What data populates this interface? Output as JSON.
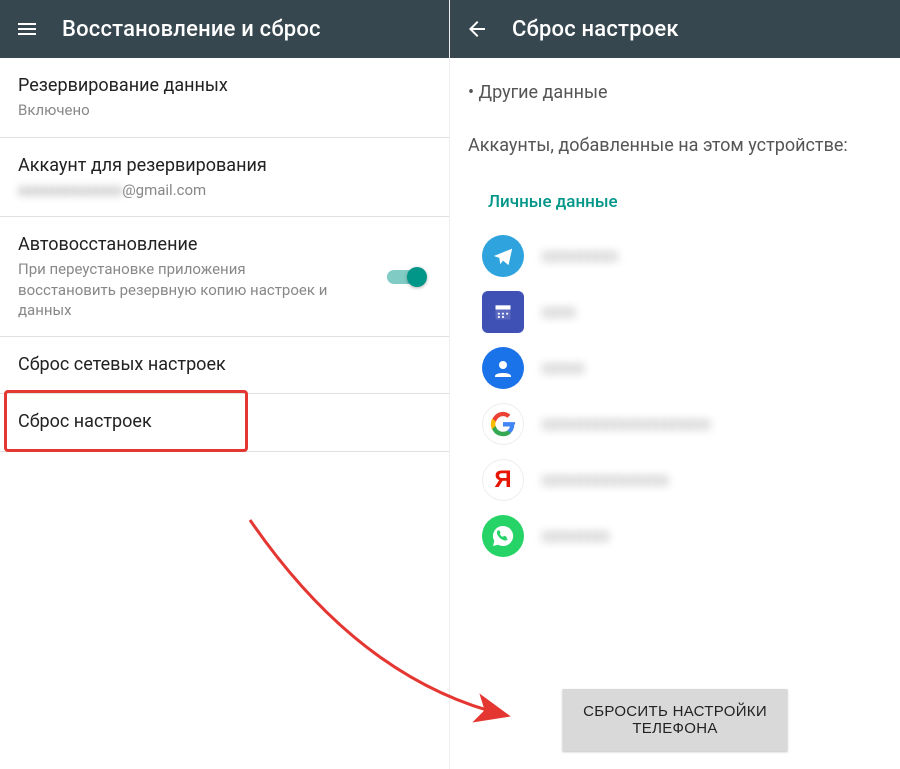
{
  "left": {
    "title": "Восстановление и сброс",
    "items": [
      {
        "primary": "Резервирование данных",
        "secondary": "Включено"
      },
      {
        "primary": "Аккаунт для резервирования",
        "secondary_blur": "xxxxxxxxxxxxxx@gmail.com",
        "suffix": "@gmail.com"
      },
      {
        "primary": "Автовосстановление",
        "secondary": "При переустановке приложения восстановить резервную копию настроек и данных",
        "toggle": true
      },
      {
        "primary": "Сброс сетевых настроек"
      },
      {
        "primary": "Сброс настроек",
        "highlight": true
      }
    ]
  },
  "right": {
    "title": "Сброс настроек",
    "bullet": "• Другие данные",
    "accounts_heading": "Аккаунты, добавленные на этом устройстве:",
    "section": "Личные данные",
    "accounts": [
      {
        "icon": "telegram",
        "label": "xxxxxxxxx"
      },
      {
        "icon": "calendar",
        "label": "xxxx"
      },
      {
        "icon": "contact",
        "label": "xxxxx"
      },
      {
        "icon": "google",
        "label": "xxxxxxxxxxxxxxxxxxxx"
      },
      {
        "icon": "yandex",
        "label": "xxxxxxxxxxxxxxx"
      },
      {
        "icon": "whatsapp",
        "label": "xxxxxxxx"
      }
    ],
    "reset_button": "СБРОСИТЬ НАСТРОЙКИ ТЕЛЕФОНА"
  }
}
